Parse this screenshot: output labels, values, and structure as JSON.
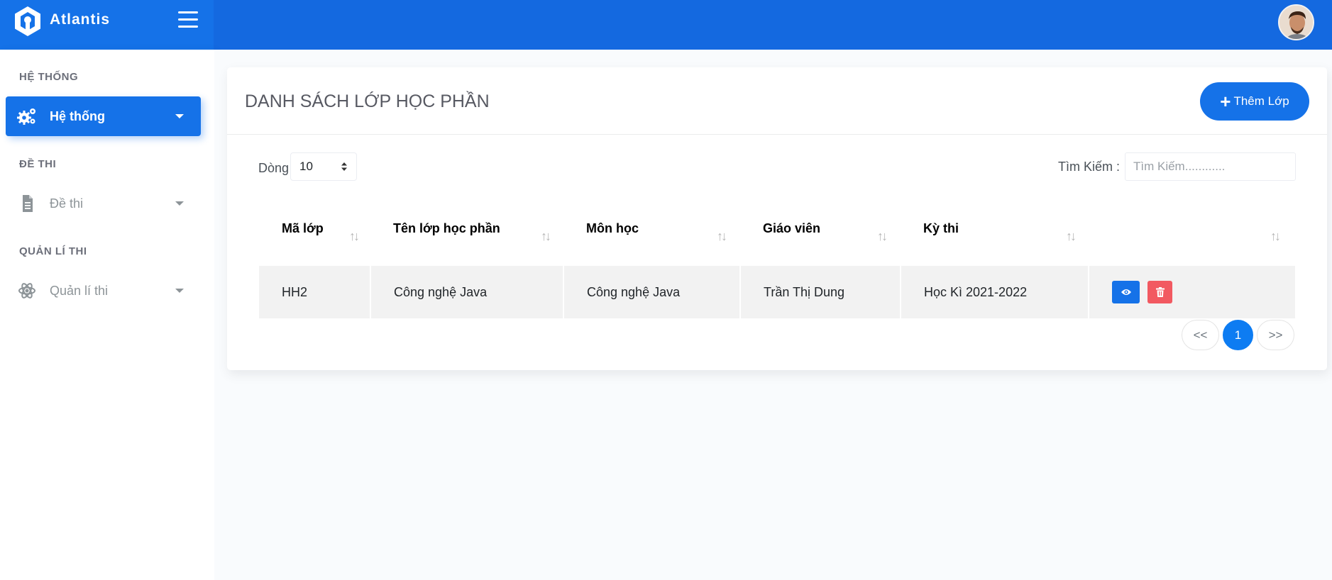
{
  "brand": {
    "name": "Atlantis"
  },
  "sidebar": {
    "sections": [
      {
        "title": "HỆ THỐNG",
        "item": {
          "label": "Hệ thống",
          "icon": "gears-icon",
          "active": true
        }
      },
      {
        "title": "ĐỀ THI",
        "item": {
          "label": "Đề thi",
          "icon": "file-icon",
          "active": false
        }
      },
      {
        "title": "QUẢN LÍ THI",
        "item": {
          "label": "Quản lí thi",
          "icon": "atom-icon",
          "active": false
        }
      }
    ]
  },
  "main": {
    "title": "DANH SÁCH LỚP HỌC PHẦN",
    "add_button_label": "Thêm Lớp",
    "rows_label": "Dòng",
    "rows_value": "10",
    "search_label": "Tìm Kiếm :",
    "search_placeholder": "Tìm Kiếm............",
    "table": {
      "headers": [
        "Mã lớp",
        "Tên lớp học phần",
        "Môn học",
        "Giáo viên",
        "Kỳ thi",
        ""
      ],
      "rows": [
        [
          "HH2",
          "Công nghệ Java",
          "Công nghệ Java",
          "Trần Thị Dung",
          "Học Kì 2021-2022"
        ]
      ]
    },
    "pagination": {
      "prev": "<<",
      "current": "1",
      "next": ">>"
    }
  },
  "colors": {
    "primary": "#1572e8",
    "danger": "#f25961",
    "topbar": "#1469e0"
  }
}
